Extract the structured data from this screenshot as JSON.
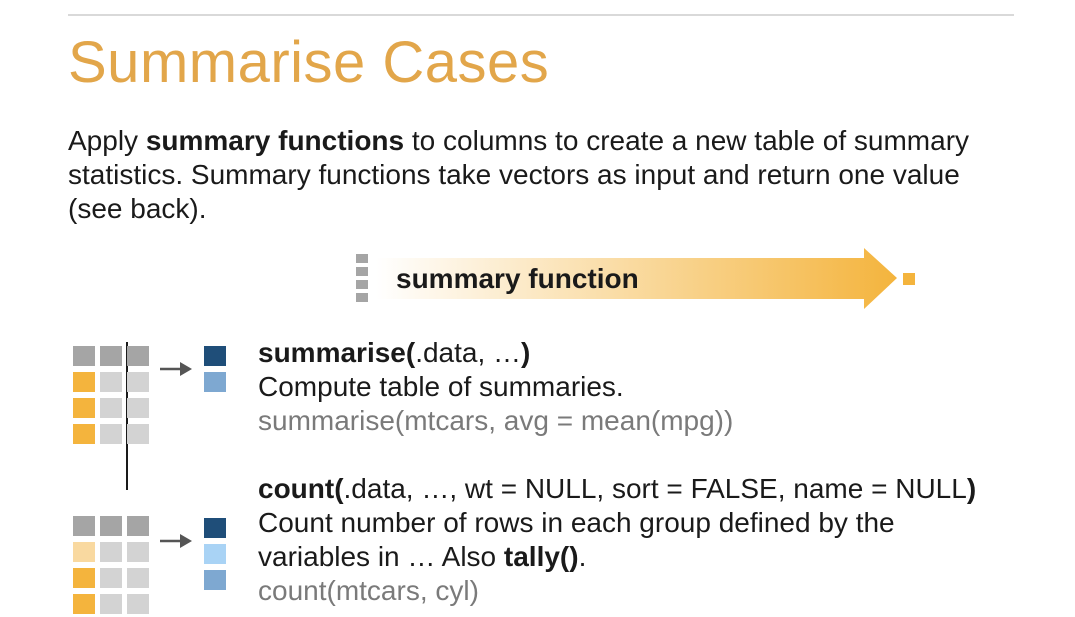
{
  "title": "Summarise Cases",
  "intro": {
    "prefix": "Apply ",
    "bold": "summary functions",
    "suffix": " to columns to create a new table of summary statistics. Summary functions take vectors as input and return one value (see back)."
  },
  "banner": {
    "label": "summary function"
  },
  "functions": [
    {
      "sig_bold_open": "summarise(",
      "sig_args": ".data, …",
      "sig_bold_close": ")",
      "description": "Compute table of summaries.",
      "example": "summarise(mtcars, avg = mean(mpg))"
    },
    {
      "sig_bold_open": "count(",
      "sig_args": ".data, …, wt = NULL, sort = FALSE, name = NULL",
      "sig_bold_close": ")",
      "description": " Count number of rows in each group defined by the variables in … Also ",
      "also_bold": "tally()",
      "also_end": ".",
      "example": "count(mtcars, cyl)"
    }
  ],
  "colors": {
    "title": "#e2a64a",
    "orange": "#f4b43d",
    "orange_light": "#f9d9a0",
    "gray_header": "#a5a5a5",
    "gray_cell": "#d3d3d3",
    "navy": "#1f4e79",
    "blue": "#7ea8d1",
    "blue_light": "#a9d3f5",
    "example_text": "#7a7a7a"
  }
}
